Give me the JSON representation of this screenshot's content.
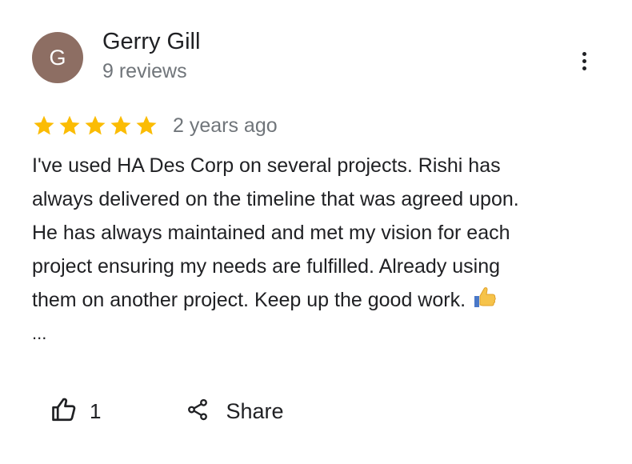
{
  "author": {
    "initial": "G",
    "name": "Gerry Gill",
    "review_count": "9 reviews",
    "avatar_color": "#8d6e63"
  },
  "review": {
    "rating": 5,
    "rating_max": 5,
    "star_color": "#fbbc04",
    "date": "2 years ago",
    "text_lines": [
      "I've used HA Des Corp on several projects. Rishi has",
      "always delivered on the timeline that was agreed upon.",
      "He has always maintained and met my vision for each",
      "project ensuring my needs are fulfilled. Already using",
      "them on another project. Keep up the good work."
    ],
    "emoji": "thumbs-up-emoji",
    "truncation": "..."
  },
  "actions": {
    "like_count": "1",
    "share_label": "Share"
  },
  "icons": {
    "more": "more-vert-icon",
    "like": "thumb-up-outline-icon",
    "share": "share-icon",
    "star": "star-icon"
  }
}
